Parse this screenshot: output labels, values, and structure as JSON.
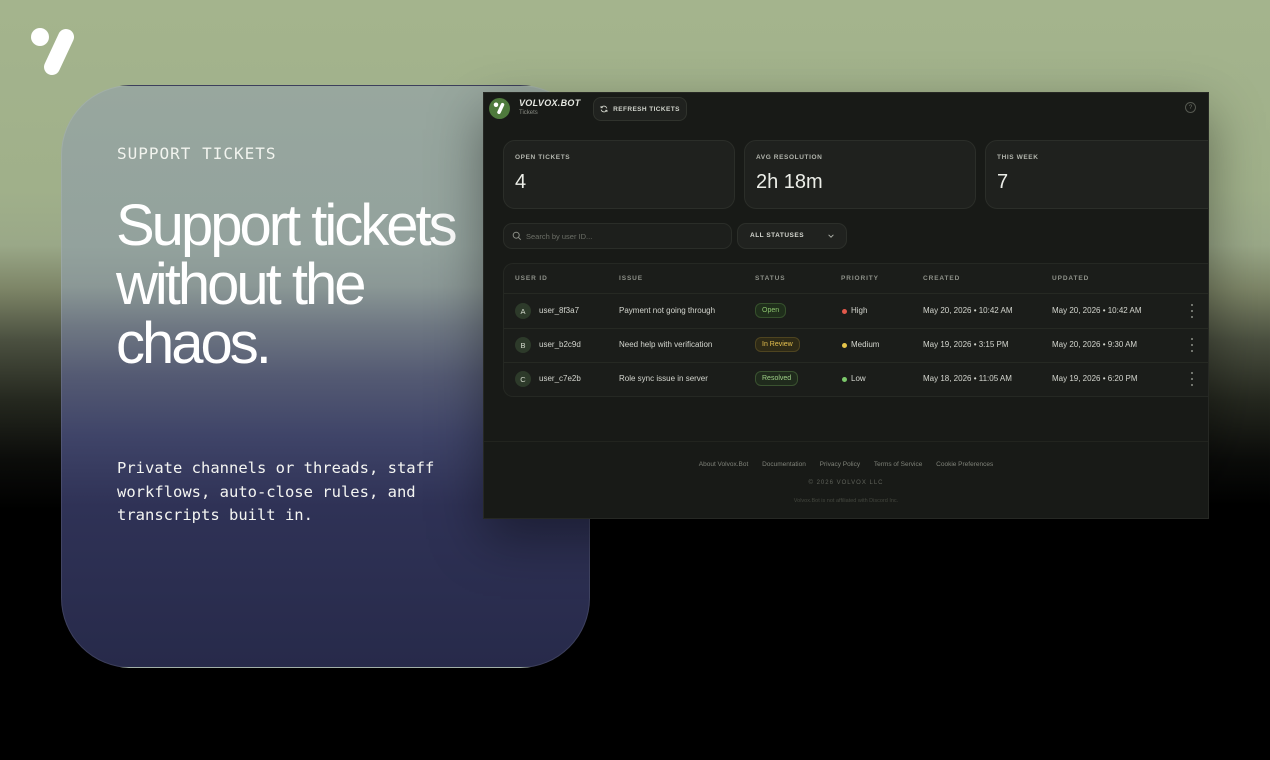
{
  "colors": {
    "accent": "#4e7a3c",
    "status_open": "#8cc46e",
    "status_review": "#e5c04f",
    "priority_high": "#e2594b",
    "priority_medium": "#e6c54a",
    "priority_low": "#7bc86a"
  },
  "hero": {
    "logo_icon": "volvox-logo-icon",
    "eyebrow": "SUPPORT TICKETS",
    "headline": "Support tickets without the chaos.",
    "subcopy": "Private channels or threads, staff workflows, auto-close rules, and transcripts built in."
  },
  "app": {
    "brand": "VOLVOX.BOT",
    "page": "Tickets",
    "refresh_label": "REFRESH TICKETS",
    "help_icon": "help-icon",
    "stats": [
      {
        "label": "OPEN TICKETS",
        "value": "4"
      },
      {
        "label": "AVG RESOLUTION",
        "value": "2h 18m"
      },
      {
        "label": "THIS WEEK",
        "value": "7"
      }
    ],
    "search": {
      "placeholder": "Search by user ID..."
    },
    "status_filter": "ALL STATUSES",
    "table": {
      "columns": [
        "USER ID",
        "ISSUE",
        "STATUS",
        "PRIORITY",
        "CREATED",
        "UPDATED"
      ],
      "rows": [
        {
          "avatar": "A",
          "user_id": "user_8f3a7",
          "issue": "Payment not going through",
          "status": "Open",
          "priority": "High",
          "created": "May 20, 2026 • 10:42 AM",
          "updated": "May 20, 2026 • 10:42 AM"
        },
        {
          "avatar": "B",
          "user_id": "user_b2c9d",
          "issue": "Need help with verification",
          "status": "In Review",
          "priority": "Medium",
          "created": "May 19, 2026 • 3:15 PM",
          "updated": "May 20, 2026 • 9:30 AM"
        },
        {
          "avatar": "C",
          "user_id": "user_c7e2b",
          "issue": "Role sync issue in server",
          "status": "Resolved",
          "priority": "Low",
          "created": "May 18, 2026 • 11:05 AM",
          "updated": "May 19, 2026 • 6:20 PM"
        }
      ]
    },
    "footer": {
      "links": [
        "About Volvox.Bot",
        "Documentation",
        "Privacy Policy",
        "Terms of Service",
        "Cookie Preferences"
      ],
      "copyright": "© 2026 VOLVOX LLC",
      "disclaimer": "Volvox.Bot is not affiliated with Discord Inc."
    }
  }
}
